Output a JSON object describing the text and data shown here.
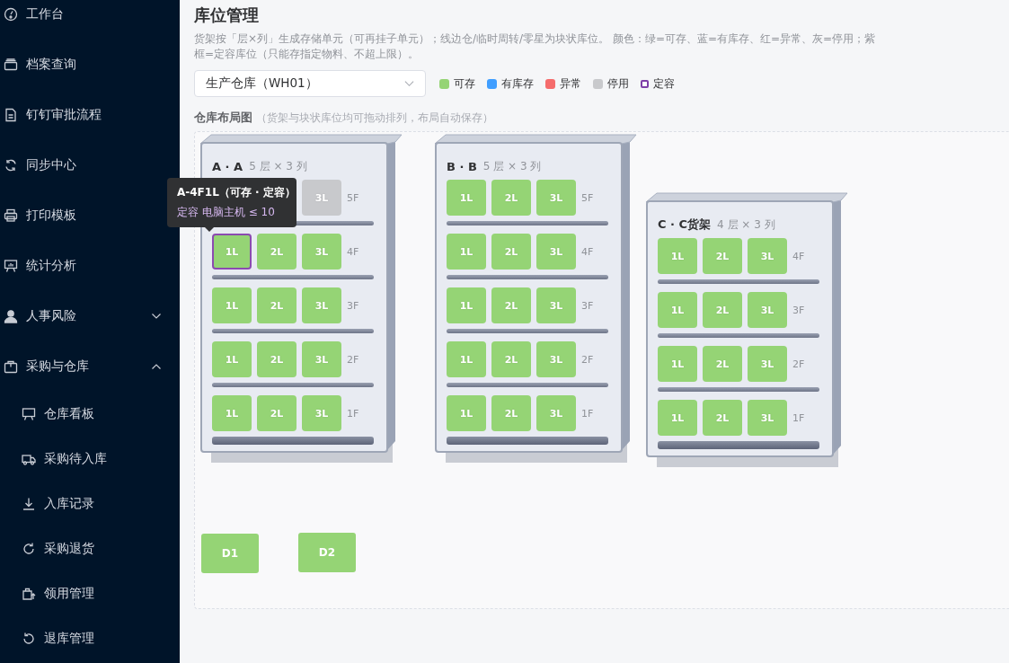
{
  "sidebar": {
    "items": [
      {
        "label": "工作台",
        "kind": "gauge"
      },
      {
        "label": "档案查询",
        "kind": "archive"
      },
      {
        "label": "钉钉审批流程",
        "kind": "document"
      },
      {
        "label": "同步中心",
        "kind": "sync"
      },
      {
        "label": "打印模板",
        "kind": "printer"
      },
      {
        "label": "统计分析",
        "kind": "easel"
      },
      {
        "label": "人事风险",
        "kind": "person",
        "expanded": false
      },
      {
        "label": "采购与仓库",
        "kind": "bag",
        "expanded": true,
        "children": [
          {
            "label": "仓库看板",
            "kind": "easel"
          },
          {
            "label": "采购待入库",
            "kind": "truck"
          },
          {
            "label": "入库记录",
            "kind": "download"
          },
          {
            "label": "采购退货",
            "kind": "refresh"
          },
          {
            "label": "领用管理",
            "kind": "bagup"
          },
          {
            "label": "退库管理",
            "kind": "undo"
          }
        ]
      }
    ]
  },
  "page": {
    "title": "库位管理",
    "description": "货架按「层×列」生成存储单元（可再挂子单元）；线边仓/临时周转/零星为块状库位。 颜色：绿=可存、蓝=有库存、红=异常、灰=停用；紫框=定容库位（只能存指定物料、不超上限）。",
    "warehouse_select": {
      "value": "生产仓库（WH01）"
    },
    "legend": [
      {
        "label": "可存",
        "kind": "fill",
        "color": "#95d475"
      },
      {
        "label": "有库存",
        "kind": "fill",
        "color": "#409eff"
      },
      {
        "label": "异常",
        "kind": "fill",
        "color": "#f56c6c"
      },
      {
        "label": "停用",
        "kind": "fill",
        "color": "#c8c9cc"
      },
      {
        "label": "定容",
        "kind": "outline",
        "color": "#7e3fa8"
      }
    ],
    "layout": {
      "title": "仓库布局图",
      "hint": "（货架与块状库位均可拖动排列，布局自动保存）",
      "racks": [
        {
          "name": "A · A",
          "size": "5 层 × 3 列",
          "rows": [
            {
              "floor": "5F",
              "cells": [
                {
                  "kind": "covered"
                },
                {
                  "kind": "covered"
                },
                {
                  "kind": "disabled",
                  "label": "3L",
                  "fixed": false
                }
              ]
            },
            {
              "floor": "4F",
              "cells": [
                {
                  "kind": "available",
                  "label": "1L",
                  "fixed": true
                },
                {
                  "kind": "available",
                  "label": "2L",
                  "fixed": false
                },
                {
                  "kind": "available",
                  "label": "3L",
                  "fixed": false
                }
              ]
            },
            {
              "floor": "3F",
              "cells": [
                {
                  "kind": "available",
                  "label": "1L",
                  "fixed": false
                },
                {
                  "kind": "available",
                  "label": "2L",
                  "fixed": false
                },
                {
                  "kind": "available",
                  "label": "3L",
                  "fixed": false
                }
              ]
            },
            {
              "floor": "2F",
              "cells": [
                {
                  "kind": "available",
                  "label": "1L",
                  "fixed": false
                },
                {
                  "kind": "available",
                  "label": "2L",
                  "fixed": false
                },
                {
                  "kind": "available",
                  "label": "3L",
                  "fixed": false
                }
              ]
            },
            {
              "floor": "1F",
              "cells": [
                {
                  "kind": "available",
                  "label": "1L",
                  "fixed": false
                },
                {
                  "kind": "available",
                  "label": "2L",
                  "fixed": false
                },
                {
                  "kind": "available",
                  "label": "3L",
                  "fixed": false
                }
              ]
            }
          ]
        },
        {
          "name": "B · B",
          "size": "5 层 × 3 列",
          "rows": [
            {
              "floor": "5F",
              "cells": [
                {
                  "kind": "available",
                  "label": "1L",
                  "fixed": false
                },
                {
                  "kind": "available",
                  "label": "2L",
                  "fixed": false
                },
                {
                  "kind": "available",
                  "label": "3L",
                  "fixed": false
                }
              ]
            },
            {
              "floor": "4F",
              "cells": [
                {
                  "kind": "available",
                  "label": "1L",
                  "fixed": false
                },
                {
                  "kind": "available",
                  "label": "2L",
                  "fixed": false
                },
                {
                  "kind": "available",
                  "label": "3L",
                  "fixed": false
                }
              ]
            },
            {
              "floor": "3F",
              "cells": [
                {
                  "kind": "available",
                  "label": "1L",
                  "fixed": false
                },
                {
                  "kind": "available",
                  "label": "2L",
                  "fixed": false
                },
                {
                  "kind": "available",
                  "label": "3L",
                  "fixed": false
                }
              ]
            },
            {
              "floor": "2F",
              "cells": [
                {
                  "kind": "available",
                  "label": "1L",
                  "fixed": false
                },
                {
                  "kind": "available",
                  "label": "2L",
                  "fixed": false
                },
                {
                  "kind": "available",
                  "label": "3L",
                  "fixed": false
                }
              ]
            },
            {
              "floor": "1F",
              "cells": [
                {
                  "kind": "available",
                  "label": "1L",
                  "fixed": false
                },
                {
                  "kind": "available",
                  "label": "2L",
                  "fixed": false
                },
                {
                  "kind": "available",
                  "label": "3L",
                  "fixed": false
                }
              ]
            }
          ]
        },
        {
          "name": "C · C货架",
          "size": "4 层 × 3 列",
          "rows": [
            {
              "floor": "4F",
              "cells": [
                {
                  "kind": "available",
                  "label": "1L",
                  "fixed": false
                },
                {
                  "kind": "available",
                  "label": "2L",
                  "fixed": false
                },
                {
                  "kind": "available",
                  "label": "3L",
                  "fixed": false
                }
              ]
            },
            {
              "floor": "3F",
              "cells": [
                {
                  "kind": "available",
                  "label": "1L",
                  "fixed": false
                },
                {
                  "kind": "available",
                  "label": "2L",
                  "fixed": false
                },
                {
                  "kind": "available",
                  "label": "3L",
                  "fixed": false
                }
              ]
            },
            {
              "floor": "2F",
              "cells": [
                {
                  "kind": "available",
                  "label": "1L",
                  "fixed": false
                },
                {
                  "kind": "available",
                  "label": "2L",
                  "fixed": false
                },
                {
                  "kind": "available",
                  "label": "3L",
                  "fixed": false
                }
              ]
            },
            {
              "floor": "1F",
              "cells": [
                {
                  "kind": "available",
                  "label": "1L",
                  "fixed": false
                },
                {
                  "kind": "available",
                  "label": "2L",
                  "fixed": false
                },
                {
                  "kind": "available",
                  "label": "3L",
                  "fixed": false
                }
              ]
            }
          ]
        }
      ],
      "blocks": [
        {
          "label": "D1",
          "kind": "available"
        },
        {
          "label": "D2",
          "kind": "available"
        }
      ]
    },
    "tooltip": {
      "title": "A-4F1L（可存 · 定容）",
      "detail": "定容 电脑主机 ≤ 10"
    }
  }
}
